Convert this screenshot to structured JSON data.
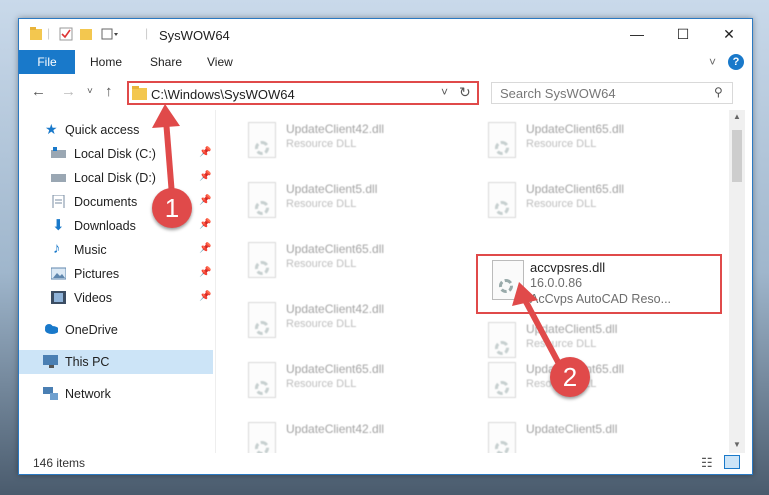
{
  "window": {
    "title": "SysWOW64"
  },
  "window_controls": {
    "minimize": "—",
    "maximize": "☐",
    "close": "✕"
  },
  "ribbon": {
    "file": "File",
    "tabs": [
      "Home",
      "Share",
      "View"
    ],
    "help": "?"
  },
  "address": {
    "path": "C:\\Windows\\SysWOW64"
  },
  "search": {
    "placeholder": "Search SysWOW64"
  },
  "sidebar": {
    "items": [
      {
        "label": "Quick access",
        "icon": "star-icon"
      },
      {
        "label": "Local Disk (C:)",
        "icon": "drive-icon",
        "pinned": true
      },
      {
        "label": "Local Disk (D:)",
        "icon": "drive-icon",
        "pinned": true
      },
      {
        "label": "Documents",
        "icon": "documents-icon",
        "pinned": true
      },
      {
        "label": "Downloads",
        "icon": "download-icon",
        "pinned": true
      },
      {
        "label": "Music",
        "icon": "music-icon",
        "pinned": true
      },
      {
        "label": "Pictures",
        "icon": "pictures-icon",
        "pinned": true
      },
      {
        "label": "Videos",
        "icon": "videos-icon",
        "pinned": true
      },
      {
        "label": "OneDrive",
        "icon": "cloud-icon"
      },
      {
        "label": "This PC",
        "icon": "computer-icon",
        "selected": true
      },
      {
        "label": "Network",
        "icon": "network-icon"
      }
    ]
  },
  "files": [
    {
      "name": "UpdateClient42.dll",
      "type": "Resource DLL"
    },
    {
      "name": "UpdateClient65.dll",
      "type": "Resource DLL"
    },
    {
      "name": "UpdateClient5.dll",
      "type": "Resource DLL"
    },
    {
      "name": "UpdateClient65.dll",
      "type": "Resource DLL"
    },
    {
      "name": "UpdateClient65.dll",
      "type": "Resource DLL"
    },
    {
      "name": "accvpsres.dll",
      "version": "16.0.0.86",
      "description": "AcCvps AutoCAD Reso...",
      "highlighted": true
    },
    {
      "name": "UpdateClient42.dll",
      "type": "Resource DLL"
    },
    {
      "name": "UpdateClient5.dll",
      "type": "Resource DLL"
    },
    {
      "name": "UpdateClient65.dll",
      "type": "Resource DLL"
    },
    {
      "name": "UpdateClient65.dll",
      "type": "Resource DLL"
    },
    {
      "name": "UpdateClient42.dll",
      "type": "Resource DLL"
    },
    {
      "name": "UpdateClient5.dll",
      "type": "Resource DLL"
    }
  ],
  "status": {
    "item_count": "146 items"
  },
  "annotations": {
    "step1": "1",
    "step2": "2"
  },
  "colors": {
    "accent": "#1979ca",
    "highlight": "#e04a4a"
  }
}
